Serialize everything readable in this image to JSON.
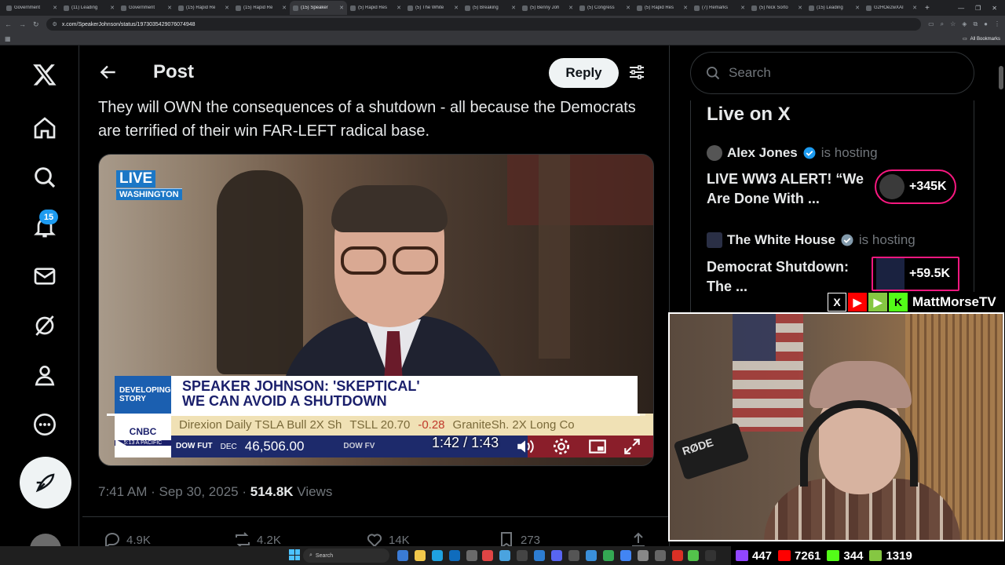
{
  "browser": {
    "tabs": [
      {
        "label": "Government"
      },
      {
        "label": "(11) Leading"
      },
      {
        "label": "Government"
      },
      {
        "label": "(15) Rapid Re"
      },
      {
        "label": "(15) Rapid Re"
      },
      {
        "label": "(15) Speaker"
      },
      {
        "label": "(5) Rapid Res"
      },
      {
        "label": "(5) The White"
      },
      {
        "label": "(5) Breaking"
      },
      {
        "label": "(5) Benny Joh"
      },
      {
        "label": "(5) Congress"
      },
      {
        "label": "(5) Rapid Res"
      },
      {
        "label": "(7) Remarks"
      },
      {
        "label": "(5) Nick Sorto"
      },
      {
        "label": "(15) Leading"
      },
      {
        "label": "G2HOe2wXAI"
      }
    ],
    "url": "x.com/SpeakerJohnson/status/1973035429076074948",
    "all_bookmarks": "All Bookmarks"
  },
  "nav": {
    "notification_count": "15"
  },
  "header": {
    "title": "Post",
    "reply_label": "Reply"
  },
  "tweet": {
    "text": "They will OWN the consequences of a shutdown - all because the Democrats are terrified of their win FAR-LEFT radical base.",
    "timestamp": "7:41 AM · Sep 30, 2025 · ",
    "views_count": "514.8K",
    "views_label": " Views",
    "replies": "4.9K",
    "reposts": "4.2K",
    "likes": "14K",
    "bookmarks": "273"
  },
  "video": {
    "live_label": "LIVE",
    "location": "WASHINGTON",
    "developing": "DEVELOPING STORY",
    "headline_line1": "SPEAKER JOHNSON: 'SKEPTICAL'",
    "headline_line2": "WE CAN AVOID A SHUTDOWN",
    "ticker_text": "Direxion Daily TSLA Bull 2X Sh",
    "ticker_symbol": "TSLL 20.70",
    "ticker_change": "-0.28",
    "ticker_more": "GraniteSh. 2X Long Co",
    "network": "CNBC",
    "net_time": "5:13 A PACIFIC",
    "dow_label": "DOW FUT",
    "dow_month": "DEC",
    "dow_value": "46,506.00",
    "fv_label": "DOW FV",
    "current_time": "1:42",
    "duration": "1:43",
    "progress": 0.99
  },
  "search": {
    "placeholder": "Search"
  },
  "live_on_x": {
    "title": "Live on X",
    "items": [
      {
        "host": "Alex Jones",
        "status": "is hosting",
        "title": "LIVE WW3 ALERT! “We Are Done With ...",
        "listeners": "+345K"
      },
      {
        "host": "The White House",
        "status": "is hosting",
        "title": "Democrat Shutdown: The ...",
        "listeners": "+59.5K"
      }
    ]
  },
  "stream": {
    "channel_name": "MattMorseTV",
    "mic_brand": "RØDE",
    "stats": [
      {
        "value": "447",
        "color": "#9146ff"
      },
      {
        "value": "7261",
        "color": "#ff0000"
      },
      {
        "value": "344",
        "color": "#53fc18"
      },
      {
        "value": "1319",
        "color": "#85c742"
      }
    ]
  },
  "taskbar": {
    "search_label": "Search"
  }
}
